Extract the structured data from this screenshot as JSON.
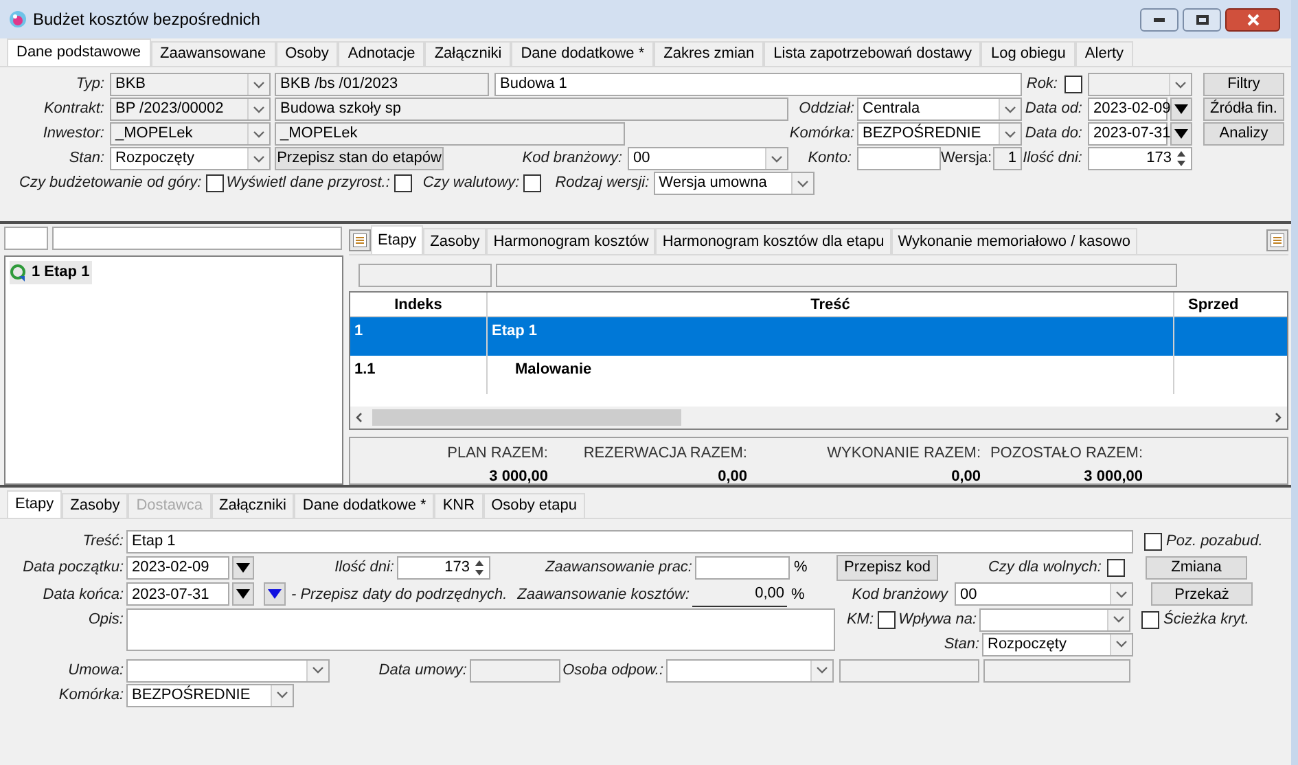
{
  "window": {
    "title": "Budżet kosztów bezpośrednich"
  },
  "main_tabs": [
    {
      "label": "Dane podstawowe",
      "selected": true
    },
    {
      "label": "Zaawansowane",
      "selected": false
    },
    {
      "label": "Osoby",
      "selected": false
    },
    {
      "label": "Adnotacje",
      "selected": false
    },
    {
      "label": "Załączniki",
      "selected": false
    },
    {
      "label": "Dane dodatkowe *",
      "selected": false
    },
    {
      "label": "Zakres zmian",
      "selected": false
    },
    {
      "label": "Lista zapotrzebowań dostawy",
      "selected": false
    },
    {
      "label": "Log obiegu",
      "selected": false
    },
    {
      "label": "Alerty",
      "selected": false
    }
  ],
  "main_form": {
    "typ": {
      "label": "Typ:",
      "value": "BKB"
    },
    "number": {
      "value": "BKB /bs  /01/2023"
    },
    "name": {
      "value": "Budowa 1"
    },
    "rok": {
      "label": "Rok:",
      "checked": false
    },
    "kontrakt": {
      "label": "Kontrakt:",
      "value": "BP  /2023/00002"
    },
    "kontrakt_name": {
      "value": "Budowa szkoły sp"
    },
    "oddzial": {
      "label": "Oddział:",
      "value": "Centrala"
    },
    "data_od": {
      "label": "Data od:",
      "value": "2023-02-09"
    },
    "inwestor": {
      "label": "Inwestor:",
      "value": "_MOPELek"
    },
    "inwestor_name": {
      "value": "_MOPELek"
    },
    "komorka": {
      "label": "Komórka:",
      "value": "BEZPOŚREDNIE"
    },
    "data_do": {
      "label": "Data do:",
      "value": "2023-07-31"
    },
    "stan": {
      "label": "Stan:",
      "value": "Rozpoczęty"
    },
    "copy_state_button": "Przepisz stan do etapów",
    "kod": {
      "label": "Kod branżowy:",
      "value": "00"
    },
    "konto": {
      "label": "Konto:"
    },
    "wersja": {
      "label": "Wersja:",
      "value": "1"
    },
    "ilosc_dni": {
      "label": "Ilość dni:",
      "value": "173"
    },
    "od_gory": {
      "label": "Czy budżetowanie od góry:",
      "checked": false
    },
    "przyrost": {
      "label": "Wyświetl dane przyrost.:",
      "checked": false
    },
    "walutowy": {
      "label": "Czy walutowy:",
      "checked": false
    },
    "rodzaj": {
      "label": "Rodzaj wersji:",
      "value": "Wersja umowna"
    }
  },
  "side_buttons": [
    "Filtry",
    "Źródła fin.",
    "Analizy"
  ],
  "tree": {
    "items": [
      {
        "label": "1 Etap 1",
        "selected": true
      }
    ]
  },
  "detail_tabs": [
    {
      "label": "Etapy",
      "selected": true
    },
    {
      "label": "Zasoby",
      "selected": false
    },
    {
      "label": "Harmonogram kosztów",
      "selected": false
    },
    {
      "label": "Harmonogram kosztów dla etapu",
      "selected": false
    },
    {
      "label": "Wykonanie memoriałowo / kasowo",
      "selected": false
    }
  ],
  "table": {
    "columns": [
      "Indeks",
      "Treść",
      "Sprzed"
    ],
    "rows": [
      {
        "index": "1",
        "text": "Etap 1",
        "selected": true,
        "children": [
          {
            "index": "1.1",
            "text": "Malowanie",
            "selected": false
          }
        ]
      }
    ]
  },
  "totals": [
    {
      "label": "PLAN RAZEM:",
      "value": "3 000,00"
    },
    {
      "label": "REZERWACJA RAZEM:",
      "value": "0,00"
    },
    {
      "label": "WYKONANIE RAZEM:",
      "value": "0,00"
    },
    {
      "label": "POZOSTAŁO RAZEM:",
      "value": "3 000,00"
    }
  ],
  "bottom_tabs": [
    {
      "label": "Etapy",
      "selected": true,
      "disabled": false
    },
    {
      "label": "Zasoby",
      "selected": false,
      "disabled": false
    },
    {
      "label": "Dostawca",
      "selected": false,
      "disabled": true
    },
    {
      "label": "Załączniki",
      "selected": false,
      "disabled": false
    },
    {
      "label": "Dane dodatkowe *",
      "selected": false,
      "disabled": false
    },
    {
      "label": "KNR",
      "selected": false,
      "disabled": false
    },
    {
      "label": "Osoby etapu",
      "selected": false,
      "disabled": false
    }
  ],
  "stage_form": {
    "tresc": {
      "label": "Treść:",
      "value": "Etap 1"
    },
    "poz_pozabud": {
      "label": "Poz. pozabud.",
      "checked": false
    },
    "data_poczatku": {
      "label": "Data początku:",
      "value": "2023-02-09"
    },
    "ilosc_dni": {
      "label": "Ilość dni:",
      "value": "173"
    },
    "zaaw_prac": {
      "label": "Zaawansowanie prac:",
      "unit": "%"
    },
    "copy_code_button": "Przepisz kod",
    "dla_wolnych": {
      "label": "Czy dla wolnych:",
      "checked": false
    },
    "data_konca": {
      "label": "Data końca:",
      "value": "2023-07-31"
    },
    "copy_dates": {
      "label": "- Przepisz daty do podrzędnych."
    },
    "zaaw_kosztow": {
      "label": "Zaawansowanie kosztów:",
      "value": "0,00",
      "unit": "%"
    },
    "kod": {
      "label": "Kod branżowy",
      "value": "00"
    },
    "opis": {
      "label": "Opis:"
    },
    "km": {
      "label": "KM:",
      "checked": false
    },
    "wplywa": {
      "label": "Wpływa na:"
    },
    "sciezka": {
      "label": "Ścieżka kryt.",
      "checked": false
    },
    "stan": {
      "label": "Stan:",
      "value": "Rozpoczęty"
    },
    "umowa": {
      "label": "Umowa:"
    },
    "data_umowy": {
      "label": "Data umowy:"
    },
    "osoba": {
      "label": "Osoba odpow.:"
    },
    "komorka": {
      "label": "Komórka:",
      "value": "BEZPOŚREDNIE"
    }
  },
  "stage_buttons": [
    "Zmiana",
    "Przekaż"
  ]
}
